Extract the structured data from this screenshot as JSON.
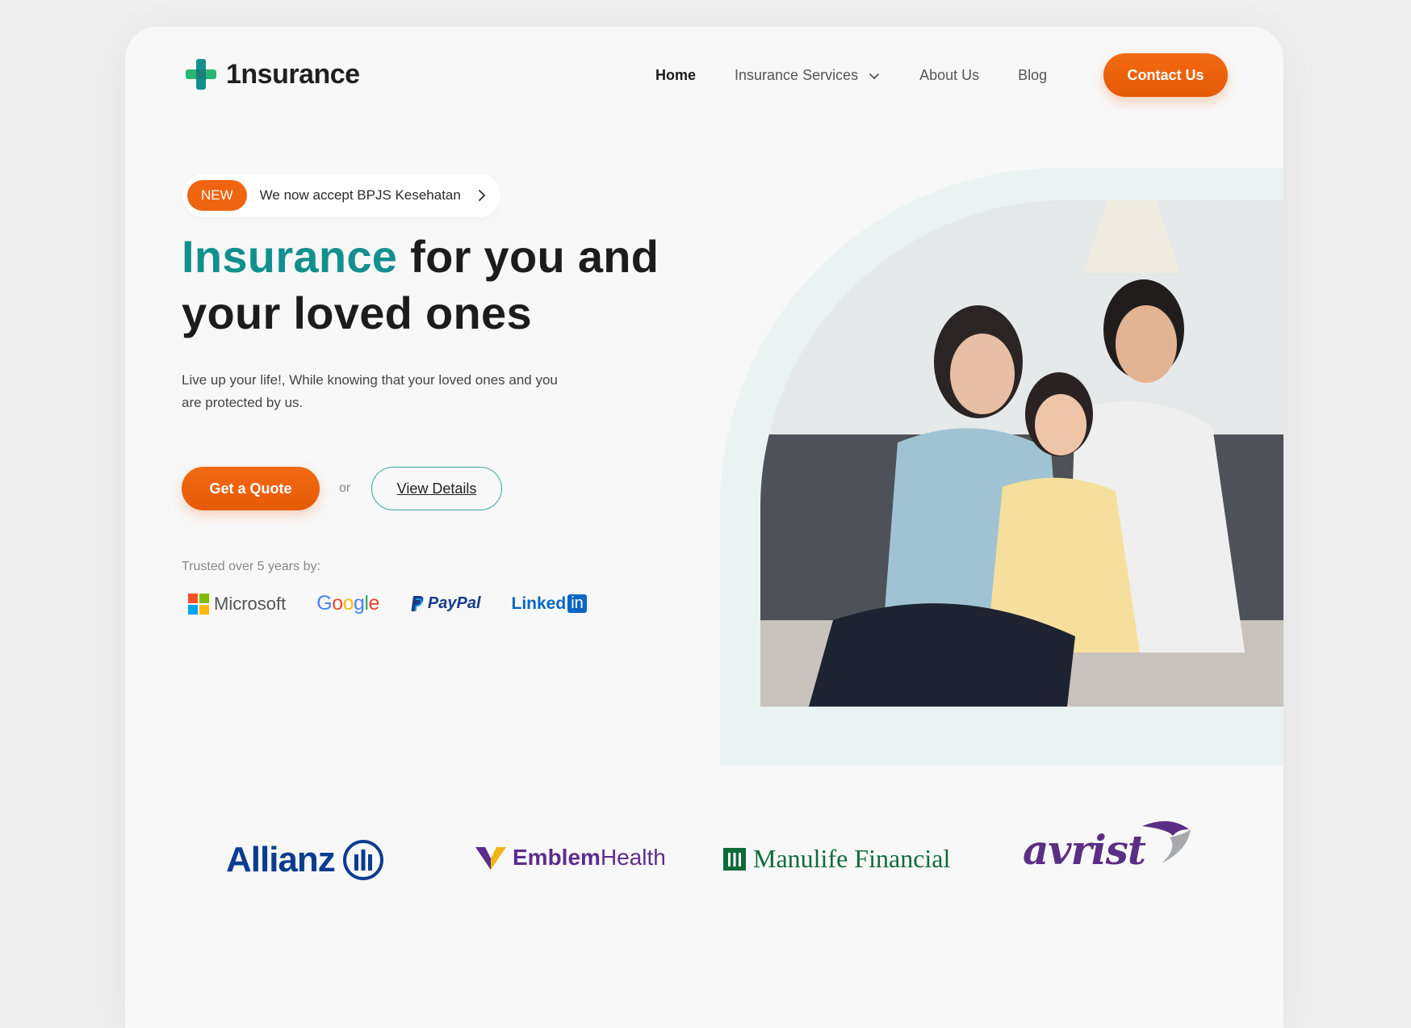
{
  "brand": {
    "name": "1nsurance",
    "colors": {
      "teal": "#12908e",
      "green": "#2bb673",
      "orange": "#ef6410"
    }
  },
  "nav": {
    "items": [
      {
        "label": "Home",
        "active": true
      },
      {
        "label": "Insurance Services",
        "has_dropdown": true
      },
      {
        "label": "About Us"
      },
      {
        "label": "Blog"
      }
    ],
    "cta": "Contact Us"
  },
  "announcement": {
    "badge": "NEW",
    "text": "We now accept BPJS Kesehatan"
  },
  "hero": {
    "headline_accent": "Insurance",
    "headline_rest": " for you and your loved ones",
    "subtext": "Live up your life!, While knowing that your loved ones and you are protected by us.",
    "primary_cta": "Get a Quote",
    "separator": "or",
    "secondary_cta": "View Details",
    "image_icon": "family-photo"
  },
  "trusted": {
    "label": "Trusted over 5 years by:",
    "logos": {
      "microsoft": "Microsoft",
      "google": "Google",
      "paypal": "PayPal",
      "linkedin_a": "Linked",
      "linkedin_b": "in"
    }
  },
  "partners": {
    "allianz": "Allianz",
    "emblem_a": "Emblem",
    "emblem_b": "Health",
    "manulife": "Manulife Financial",
    "avrist": "avrist"
  }
}
